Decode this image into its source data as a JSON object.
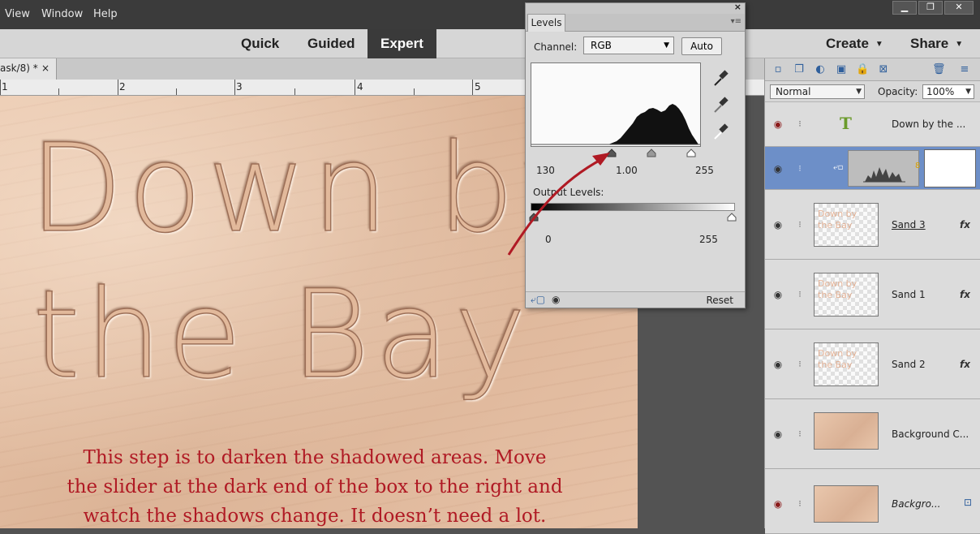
{
  "menu": {
    "view": "View",
    "window": "Window",
    "help": "Help"
  },
  "window_buttons": {
    "minimize": "▁",
    "restore": "❐",
    "close": "✕"
  },
  "modes": {
    "quick": "Quick",
    "guided": "Guided",
    "expert": "Expert"
  },
  "right_menus": {
    "create": "Create",
    "share": "Share"
  },
  "document_tab": {
    "title": "ask/8) *",
    "close": "×"
  },
  "ruler": {
    "marks": [
      "1",
      "2",
      "3",
      "4",
      "5"
    ]
  },
  "canvas": {
    "sand_line1": "Down by",
    "sand_line2": "the Bay",
    "caption_line1": "This step is to darken the shadowed areas. Move",
    "caption_line2": "the slider at the dark end of the box to the right and",
    "caption_line3": "watch the shadows change. It doesn’t need a lot."
  },
  "levels": {
    "tab": "Levels",
    "channel_label": "Channel:",
    "channel_value": "RGB",
    "auto_button": "Auto",
    "input_black": "130",
    "input_gamma": "1.00",
    "input_white": "255",
    "output_label": "Output Levels:",
    "output_black": "0",
    "output_white": "255",
    "reset": "Reset"
  },
  "layers_panel": {
    "blend_mode": "Normal",
    "opacity_label": "Opacity:",
    "opacity_value": "100%",
    "layers": [
      {
        "name": "Down by the ...",
        "visible": false,
        "type": "text"
      },
      {
        "name": "",
        "visible": true,
        "type": "levels-adjustment",
        "selected": true
      },
      {
        "name": "Sand 3",
        "visible": true,
        "type": "pixel",
        "fx": "fx"
      },
      {
        "name": "Sand 1",
        "visible": true,
        "type": "pixel",
        "fx": "fx"
      },
      {
        "name": "Sand 2",
        "visible": true,
        "type": "pixel",
        "fx": "fx"
      },
      {
        "name": "Background C...",
        "visible": true,
        "type": "pixel"
      },
      {
        "name": "Backgro...",
        "visible": false,
        "type": "background",
        "locked": true
      }
    ]
  },
  "colors": {
    "caption": "#b01a24",
    "arrow": "#b01a24",
    "selected_layer": "#6d8fc8"
  }
}
